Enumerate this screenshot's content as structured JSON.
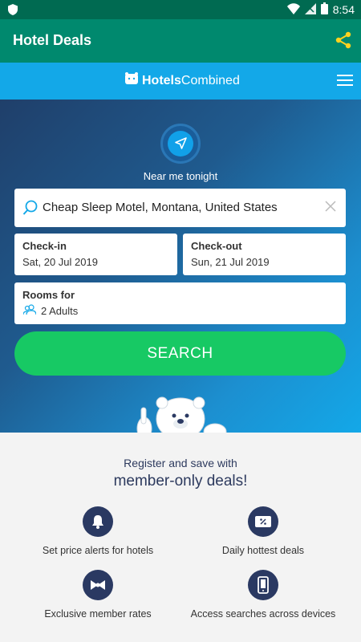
{
  "statusbar": {
    "time": "8:54"
  },
  "appbar": {
    "title": "Hotel Deals"
  },
  "brand": {
    "name_part1": "Hotels",
    "name_part2": "Combined"
  },
  "hero": {
    "near_label": "Near me tonight",
    "search": {
      "value": "Cheap Sleep Motel, Montana, United States"
    },
    "checkin": {
      "label": "Check-in",
      "value": "Sat, 20 Jul 2019"
    },
    "checkout": {
      "label": "Check-out",
      "value": "Sun, 21 Jul 2019"
    },
    "rooms": {
      "label": "Rooms for",
      "value": "2 Adults"
    },
    "search_button": "SEARCH"
  },
  "member": {
    "line1": "Register and save with",
    "line2": "member-only deals!",
    "features": [
      {
        "icon": "bell-icon",
        "label": "Set price alerts for hotels"
      },
      {
        "icon": "percent-ticket-icon",
        "label": "Daily hottest deals"
      },
      {
        "icon": "bowtie-icon",
        "label": "Exclusive member rates"
      },
      {
        "icon": "phone-icon",
        "label": "Access searches across devices"
      }
    ]
  },
  "colors": {
    "status": "#006a51",
    "appbar": "#00896e",
    "brand": "#13a8e8",
    "search_button": "#17c964",
    "feature_icon": "#2a3962"
  }
}
